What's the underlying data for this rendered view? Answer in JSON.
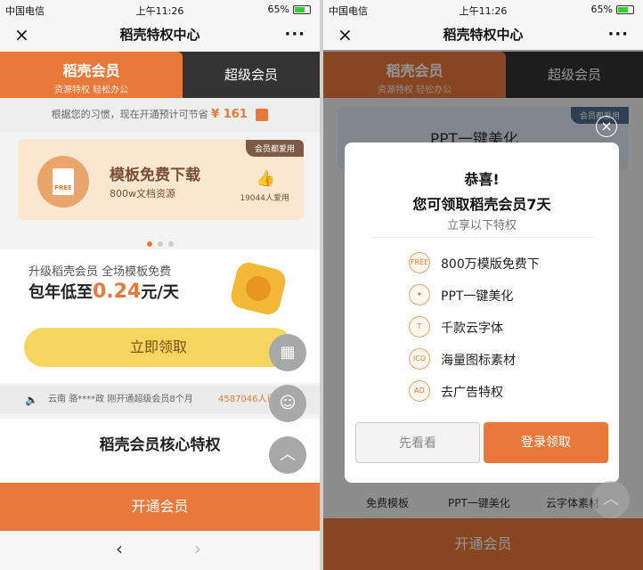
{
  "status": {
    "carrier": "中国电信",
    "time": "上午11:26",
    "battery": "65%"
  },
  "nav": {
    "title": "稻壳特权中心",
    "close": "×",
    "more": "···"
  },
  "tabs": {
    "active_title": "稻壳会员",
    "active_sub": "资源特权 轻松办公",
    "inactive": "超级会员"
  },
  "savings": {
    "text": "根据您的习惯，现在开通预计可节省",
    "amount": "¥ 161"
  },
  "banner": {
    "tag": "会员都爱用",
    "icon_text": "FREE",
    "title": "模板免费下载",
    "sub": "800w文档资源",
    "count": "19044人爱用"
  },
  "promo": {
    "line1": "升级稻壳会员 全场模板免费",
    "line2_pre": "包年低至",
    "price": "0.24",
    "line2_post": "元/天",
    "button": "立即领取"
  },
  "ticker": {
    "text": "云南 骆****政 刚开通超级会员8个月",
    "count": "4587046人已"
  },
  "core": {
    "title": "稻壳会员核心特权"
  },
  "footer": {
    "open_label": "开通会员"
  },
  "modal": {
    "title": "恭喜!",
    "subtitle": "您可领取稻壳会员7天",
    "lead": "立享以下特权",
    "features": [
      {
        "icon": "FREE",
        "label": "800万模版免费下"
      },
      {
        "icon": "✦",
        "label": "PPT一键美化"
      },
      {
        "icon": "T",
        "label": "千款云字体"
      },
      {
        "icon": "ICO",
        "label": "海量图标素材"
      },
      {
        "icon": "AD",
        "label": "去广告特权"
      }
    ],
    "cancel": "先看看",
    "confirm": "登录领取"
  },
  "bg2": {
    "card_title": "PPT一键美化",
    "card_tag": "会员都爱用",
    "row": [
      "免费模板",
      "PPT一键美化",
      "云字体素材"
    ]
  },
  "colors": {
    "accent": "#e8793a",
    "dark_tab": "#333333"
  }
}
